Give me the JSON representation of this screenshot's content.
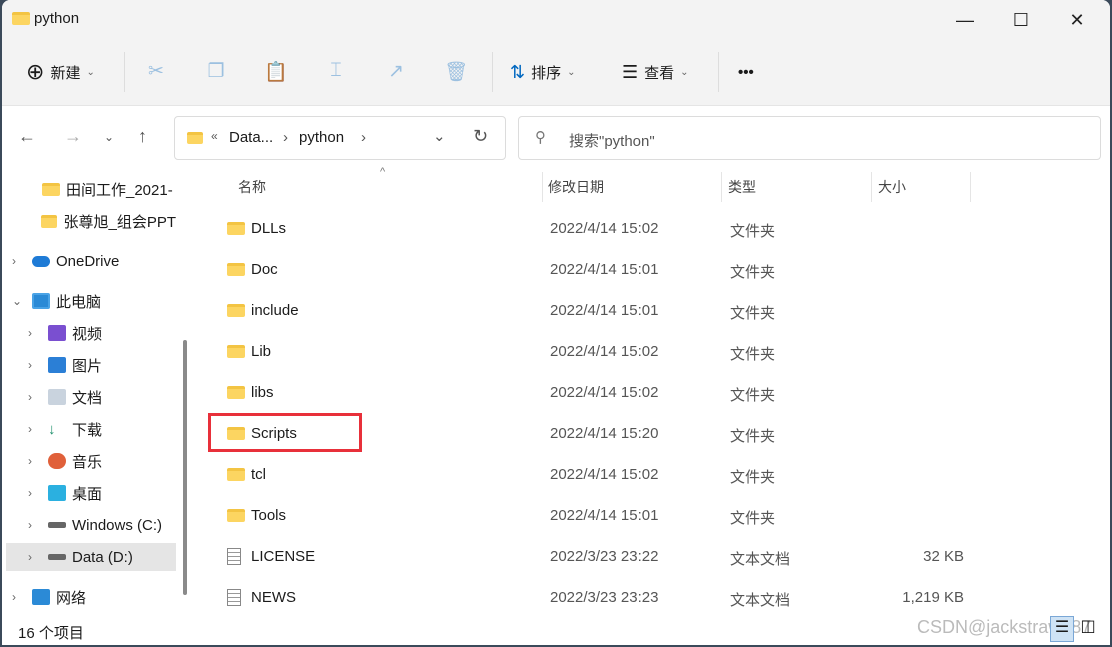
{
  "window": {
    "title": "python",
    "controls": [
      "minimize",
      "maximize",
      "close"
    ]
  },
  "toolbar": {
    "new_label": "新建",
    "sort_label": "排序",
    "view_label": "查看",
    "more": "•••",
    "icons": [
      "cut-icon",
      "copy-icon",
      "paste-icon",
      "rename-icon",
      "share-icon",
      "delete-icon"
    ]
  },
  "address": {
    "prefix": "«",
    "crumbs": [
      "Data...",
      "python"
    ]
  },
  "search": {
    "placeholder": "搜索\"python\""
  },
  "sidebar": {
    "items": [
      {
        "label": "田间工作_2021-",
        "icon": "folder"
      },
      {
        "label": "张尊旭_组会PPT",
        "icon": "folder"
      },
      {
        "label": "OneDrive",
        "icon": "cloud"
      },
      {
        "label": "此电脑",
        "icon": "computer",
        "expanded": true
      },
      {
        "label": "视频",
        "icon": "video"
      },
      {
        "label": "图片",
        "icon": "pictures"
      },
      {
        "label": "文档",
        "icon": "documents"
      },
      {
        "label": "下载",
        "icon": "download"
      },
      {
        "label": "音乐",
        "icon": "music"
      },
      {
        "label": "桌面",
        "icon": "desktop"
      },
      {
        "label": "Windows (C:)",
        "icon": "drive"
      },
      {
        "label": "Data (D:)",
        "icon": "drive",
        "selected": true
      },
      {
        "label": "网络",
        "icon": "network"
      }
    ]
  },
  "columns": {
    "name": "名称",
    "date": "修改日期",
    "type": "类型",
    "size": "大小"
  },
  "files": [
    {
      "name": "DLLs",
      "date": "2022/4/14 15:02",
      "type": "文件夹",
      "size": "",
      "kind": "folder"
    },
    {
      "name": "Doc",
      "date": "2022/4/14 15:01",
      "type": "文件夹",
      "size": "",
      "kind": "folder"
    },
    {
      "name": "include",
      "date": "2022/4/14 15:01",
      "type": "文件夹",
      "size": "",
      "kind": "folder"
    },
    {
      "name": "Lib",
      "date": "2022/4/14 15:02",
      "type": "文件夹",
      "size": "",
      "kind": "folder"
    },
    {
      "name": "libs",
      "date": "2022/4/14 15:02",
      "type": "文件夹",
      "size": "",
      "kind": "folder"
    },
    {
      "name": "Scripts",
      "date": "2022/4/14 15:20",
      "type": "文件夹",
      "size": "",
      "kind": "folder",
      "highlighted": true
    },
    {
      "name": "tcl",
      "date": "2022/4/14 15:02",
      "type": "文件夹",
      "size": "",
      "kind": "folder"
    },
    {
      "name": "Tools",
      "date": "2022/4/14 15:01",
      "type": "文件夹",
      "size": "",
      "kind": "folder"
    },
    {
      "name": "LICENSE",
      "date": "2022/3/23 23:22",
      "type": "文本文档",
      "size": "32 KB",
      "kind": "file"
    },
    {
      "name": "NEWS",
      "date": "2022/3/23 23:23",
      "type": "文本文档",
      "size": "1,219 KB",
      "kind": "file"
    }
  ],
  "status": {
    "count": "16 个项目"
  },
  "watermark": "CSDN@jackstraw787",
  "colors": {
    "highlight": "#e8303a",
    "accent": "#0067c0"
  }
}
